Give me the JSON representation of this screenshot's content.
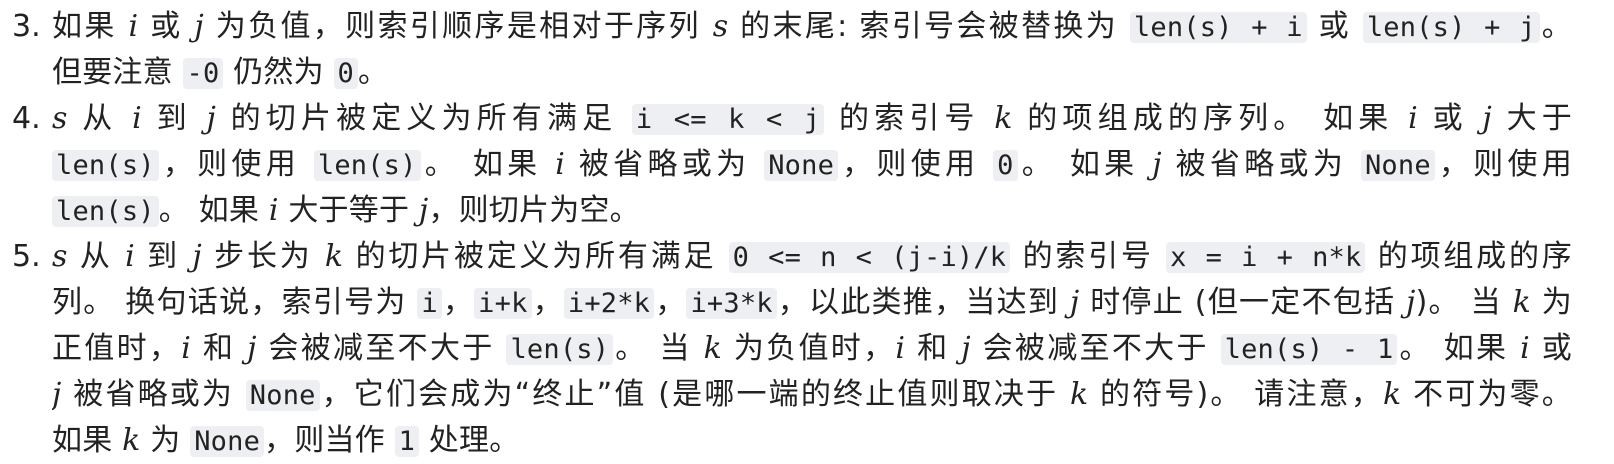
{
  "items": [
    {
      "num": "3.",
      "lines": [
        [
          {
            "t": "text",
            "v": "如果 "
          },
          {
            "t": "em",
            "v": "i"
          },
          {
            "t": "text",
            "v": " 或 "
          },
          {
            "t": "em",
            "v": "j"
          },
          {
            "t": "text",
            "v": " 为负值，则索引顺序是相对于序列 "
          },
          {
            "t": "em",
            "v": "s"
          },
          {
            "t": "text",
            "v": " 的末尾: 索引号会被替换为 "
          },
          {
            "t": "code",
            "v": "len(s) + i"
          },
          {
            "t": "text",
            "v": " 或 "
          },
          {
            "t": "code",
            "v": "len(s) + j"
          },
          {
            "t": "text",
            "v": "。"
          }
        ],
        [
          {
            "t": "text",
            "v": "但要注意 "
          },
          {
            "t": "code",
            "v": "-0"
          },
          {
            "t": "text",
            "v": " 仍然为 "
          },
          {
            "t": "code",
            "v": "0"
          },
          {
            "t": "text",
            "v": "。"
          }
        ]
      ]
    },
    {
      "num": "4.",
      "lines": [
        [
          {
            "t": "em",
            "v": "s"
          },
          {
            "t": "text",
            "v": " 从 "
          },
          {
            "t": "em",
            "v": "i"
          },
          {
            "t": "text",
            "v": " 到 "
          },
          {
            "t": "em",
            "v": "j"
          },
          {
            "t": "text",
            "v": " 的切片被定义为所有满足 "
          },
          {
            "t": "code",
            "v": "i <= k < j"
          },
          {
            "t": "text",
            "v": " 的索引号 "
          },
          {
            "t": "em",
            "v": "k"
          },
          {
            "t": "text",
            "v": " 的项组成的序列。 如果 "
          },
          {
            "t": "em",
            "v": "i"
          },
          {
            "t": "text",
            "v": " 或 "
          },
          {
            "t": "em",
            "v": "j"
          },
          {
            "t": "text",
            "v": " 大于"
          }
        ],
        [
          {
            "t": "code",
            "v": "len(s)"
          },
          {
            "t": "text",
            "v": "，则使用 "
          },
          {
            "t": "code",
            "v": "len(s)"
          },
          {
            "t": "text",
            "v": "。 如果 "
          },
          {
            "t": "em",
            "v": "i"
          },
          {
            "t": "text",
            "v": " 被省略或为 "
          },
          {
            "t": "code",
            "v": "None"
          },
          {
            "t": "text",
            "v": "，则使用 "
          },
          {
            "t": "code",
            "v": "0"
          },
          {
            "t": "text",
            "v": "。 如果 "
          },
          {
            "t": "em",
            "v": "j"
          },
          {
            "t": "text",
            "v": " 被省略或为 "
          },
          {
            "t": "code",
            "v": "None"
          },
          {
            "t": "text",
            "v": "，则使用"
          }
        ],
        [
          {
            "t": "code",
            "v": "len(s)"
          },
          {
            "t": "text",
            "v": "。 如果 "
          },
          {
            "t": "em",
            "v": "i"
          },
          {
            "t": "text",
            "v": " 大于等于 "
          },
          {
            "t": "em",
            "v": "j"
          },
          {
            "t": "text",
            "v": "，则切片为空。"
          }
        ]
      ]
    },
    {
      "num": "5.",
      "lines": [
        [
          {
            "t": "em",
            "v": "s"
          },
          {
            "t": "text",
            "v": " 从 "
          },
          {
            "t": "em",
            "v": "i"
          },
          {
            "t": "text",
            "v": " 到 "
          },
          {
            "t": "em",
            "v": "j"
          },
          {
            "t": "text",
            "v": " 步长为 "
          },
          {
            "t": "em",
            "v": "k"
          },
          {
            "t": "text",
            "v": " 的切片被定义为所有满足 "
          },
          {
            "t": "code",
            "v": "0 <= n < (j-i)/k"
          },
          {
            "t": "text",
            "v": " 的索引号 "
          },
          {
            "t": "code",
            "v": "x = i + n*k"
          },
          {
            "t": "text",
            "v": " 的项组成的序"
          }
        ],
        [
          {
            "t": "text",
            "v": "列。 换句话说，索引号为 "
          },
          {
            "t": "code",
            "v": "i"
          },
          {
            "t": "text",
            "v": "，"
          },
          {
            "t": "code",
            "v": "i+k"
          },
          {
            "t": "text",
            "v": "，"
          },
          {
            "t": "code",
            "v": "i+2*k"
          },
          {
            "t": "text",
            "v": "，"
          },
          {
            "t": "code",
            "v": "i+3*k"
          },
          {
            "t": "text",
            "v": "，以此类推，当达到 "
          },
          {
            "t": "em",
            "v": "j"
          },
          {
            "t": "text",
            "v": " 时停止 (但一定不包括 "
          },
          {
            "t": "em",
            "v": "j"
          },
          {
            "t": "text",
            "v": ")。 当 "
          },
          {
            "t": "em",
            "v": "k"
          },
          {
            "t": "text",
            "v": " 为"
          }
        ],
        [
          {
            "t": "text",
            "v": "正值时，"
          },
          {
            "t": "em",
            "v": "i"
          },
          {
            "t": "text",
            "v": " 和 "
          },
          {
            "t": "em",
            "v": "j"
          },
          {
            "t": "text",
            "v": " 会被减至不大于 "
          },
          {
            "t": "code",
            "v": "len(s)"
          },
          {
            "t": "text",
            "v": "。 当 "
          },
          {
            "t": "em",
            "v": "k"
          },
          {
            "t": "text",
            "v": " 为负值时，"
          },
          {
            "t": "em",
            "v": "i"
          },
          {
            "t": "text",
            "v": " 和 "
          },
          {
            "t": "em",
            "v": "j"
          },
          {
            "t": "text",
            "v": " 会被减至不大于 "
          },
          {
            "t": "code",
            "v": "len(s) - 1"
          },
          {
            "t": "text",
            "v": "。 如果 "
          },
          {
            "t": "em",
            "v": "i"
          },
          {
            "t": "text",
            "v": " 或"
          }
        ],
        [
          {
            "t": "em",
            "v": "j"
          },
          {
            "t": "text",
            "v": " 被省略或为 "
          },
          {
            "t": "code",
            "v": "None"
          },
          {
            "t": "text",
            "v": "，它们会成为“终止”值 (是哪一端的终止值则取决于 "
          },
          {
            "t": "em",
            "v": "k"
          },
          {
            "t": "text",
            "v": " 的符号)。 请注意，"
          },
          {
            "t": "em",
            "v": "k"
          },
          {
            "t": "text",
            "v": " 不可为零。"
          }
        ],
        [
          {
            "t": "text",
            "v": "如果 "
          },
          {
            "t": "em",
            "v": "k"
          },
          {
            "t": "text",
            "v": " 为 "
          },
          {
            "t": "code",
            "v": "None"
          },
          {
            "t": "text",
            "v": "，则当作 "
          },
          {
            "t": "code",
            "v": "1"
          },
          {
            "t": "text",
            "v": " 处理。"
          }
        ]
      ]
    }
  ]
}
